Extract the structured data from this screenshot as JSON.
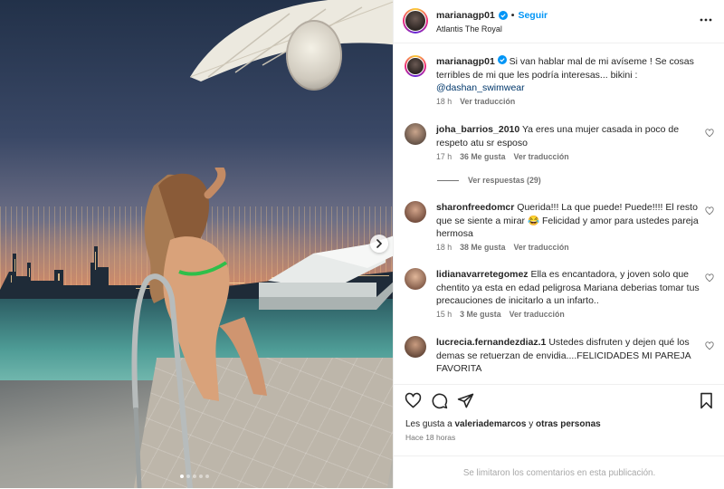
{
  "post": {
    "author": "marianagp01",
    "location": "Atlantis The Royal",
    "follow_label": "Seguir",
    "separator": "•",
    "caption": {
      "text": "Si van hablar mal de mi avíseme ! Se cosas terribles de mi que les podría interesas... bikini :",
      "mention": "@dashan_swimwear",
      "age": "18 h",
      "translate": "Ver traducción"
    },
    "accent_color": "#0095f6",
    "carousel": {
      "slides": 5,
      "current": 1
    }
  },
  "comments": [
    {
      "user": "joha_barrios_2010",
      "text": "Ya eres una mujer casada in poco de respeto atu sr esposo",
      "age": "17 h",
      "likes": "36 Me gusta",
      "translate": "Ver traducción",
      "replies": "Ver respuestas (29)"
    },
    {
      "user": "sharonfreedomcr",
      "text": "Querida!!! La que puede! Puede!!!! El resto que se siente a mirar 😂 Felicidad y amor para ustedes pareja hermosa",
      "age": "18 h",
      "likes": "38 Me gusta",
      "translate": "Ver traducción"
    },
    {
      "user": "lidianavarretegomez",
      "text": "Ella es encantadora, y joven solo que chentito ya esta en edad peligrosa Mariana deberias tomar tus precauciones de inicitarlo a un infarto..",
      "age": "15 h",
      "likes": "3 Me gusta",
      "translate": "Ver traducción"
    },
    {
      "user": "lucrecia.fernandezdiaz.1",
      "text": "Ustedes disfruten y dejen qué los demas se retuerzan de envidia....FELICIDADES MI PAREJA FAVORITA"
    }
  ],
  "footer": {
    "likes_prefix": "Les gusta a",
    "likes_user": "valeriademarcos",
    "likes_join": "y",
    "likes_others": "otras personas",
    "time": "Hace 18 horas",
    "comments_limited": "Se limitaron los comentarios en esta publicación."
  },
  "icons": [
    "verified-icon",
    "more-options-icon",
    "heart-icon",
    "comment-icon",
    "share-icon",
    "bookmark-icon",
    "chevron-right-icon"
  ]
}
